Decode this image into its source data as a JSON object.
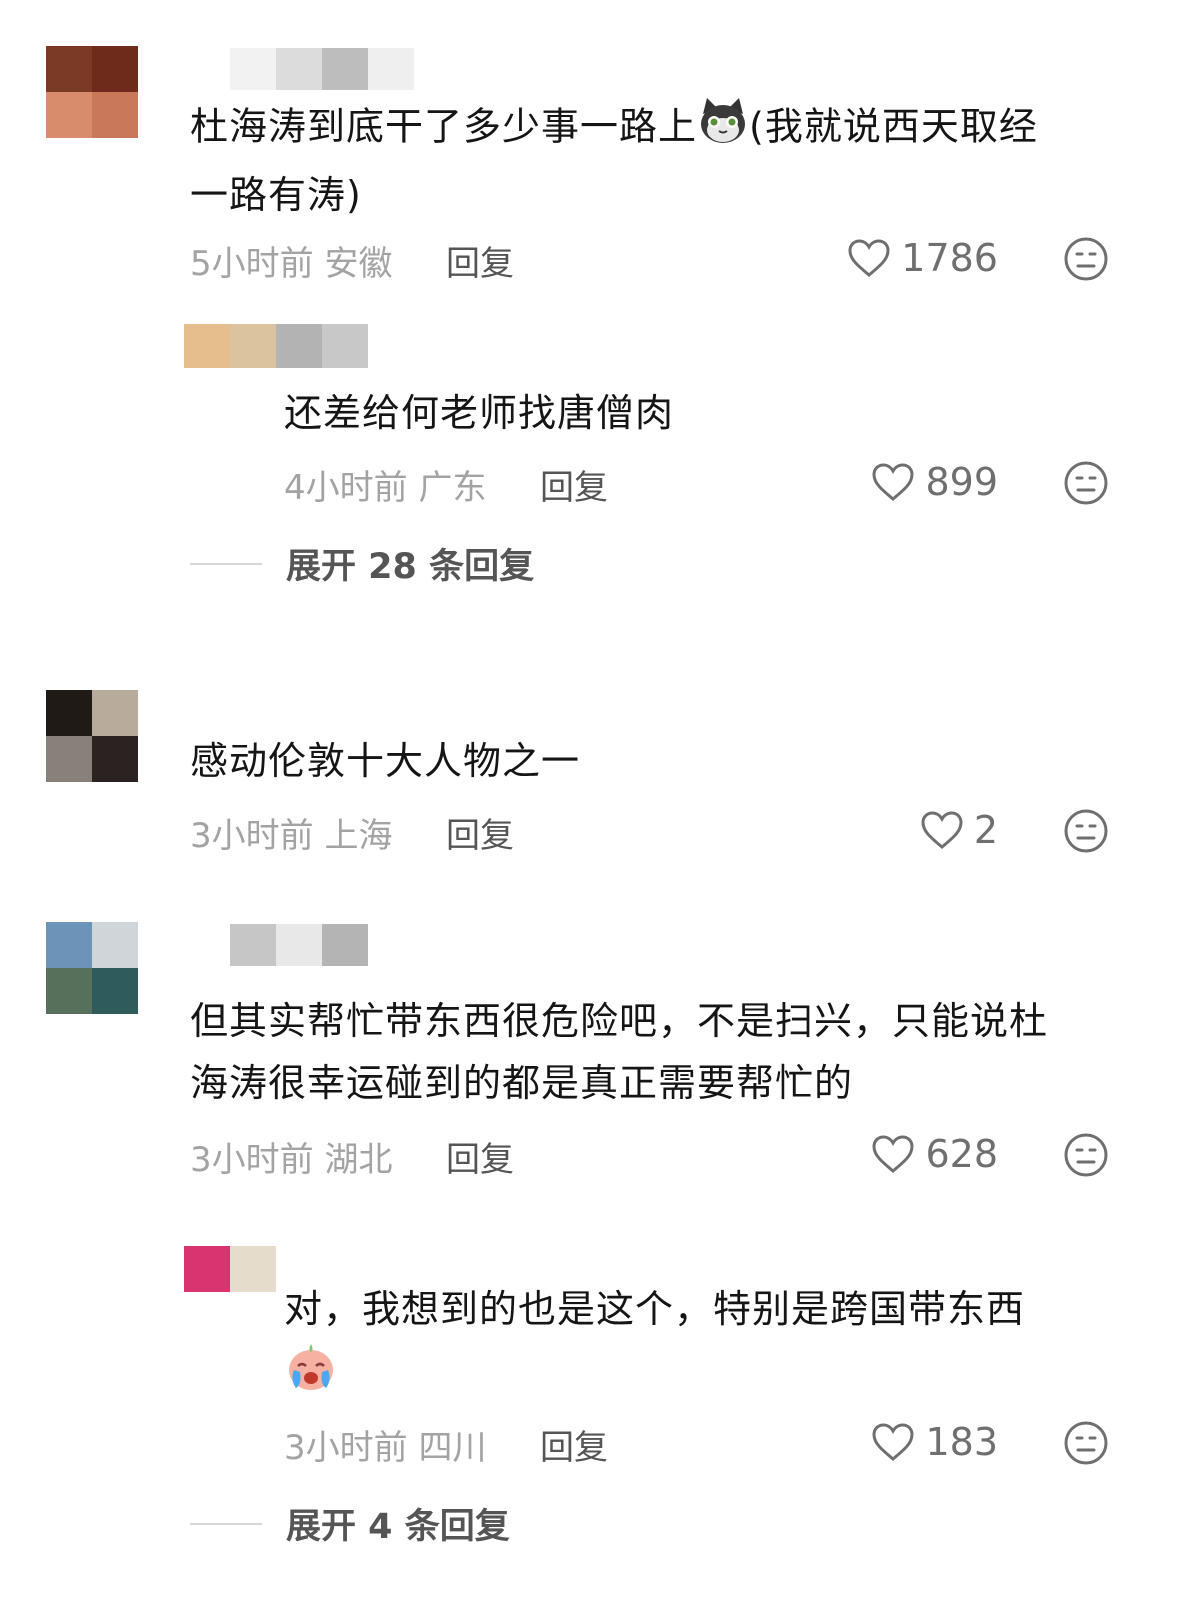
{
  "comments": [
    {
      "text_line1": "杜海涛到底干了多少事一路上",
      "text_line1b": "(我就说西天取经",
      "text_line2": "一路有涛)",
      "time": "5小时前",
      "location": "安徽",
      "reply_label": "回复",
      "likes": "1786",
      "emoji_name": "cat-emoji",
      "replies": [
        {
          "text": "还差给何老师找唐僧肉",
          "time": "4小时前",
          "location": "广东",
          "reply_label": "回复",
          "likes": "899"
        }
      ],
      "expand_label": "展开 28 条回复"
    },
    {
      "text_line1": "感动伦敦十大人物之一",
      "time": "3小时前",
      "location": "上海",
      "reply_label": "回复",
      "likes": "2"
    },
    {
      "text_line1": "但其实帮忙带东西很危险吧，不是扫兴，只能说杜",
      "text_line2": "海涛很幸运碰到的都是真正需要帮忙的",
      "time": "3小时前",
      "location": "湖北",
      "reply_label": "回复",
      "likes": "628",
      "replies": [
        {
          "text": "对，我想到的也是这个，特别是跨国带东西",
          "emoji_name": "crying-emoji",
          "time": "3小时前",
          "location": "四川",
          "reply_label": "回复",
          "likes": "183"
        }
      ],
      "expand_label": "展开 4 条回复"
    }
  ],
  "icons": {
    "like": "heart-outline-icon",
    "dislike": "neutral-face-icon"
  },
  "colors": {
    "text": "#151515",
    "meta": "#a3a3a3",
    "reply": "#555555",
    "icon": "#6f6f6f"
  }
}
